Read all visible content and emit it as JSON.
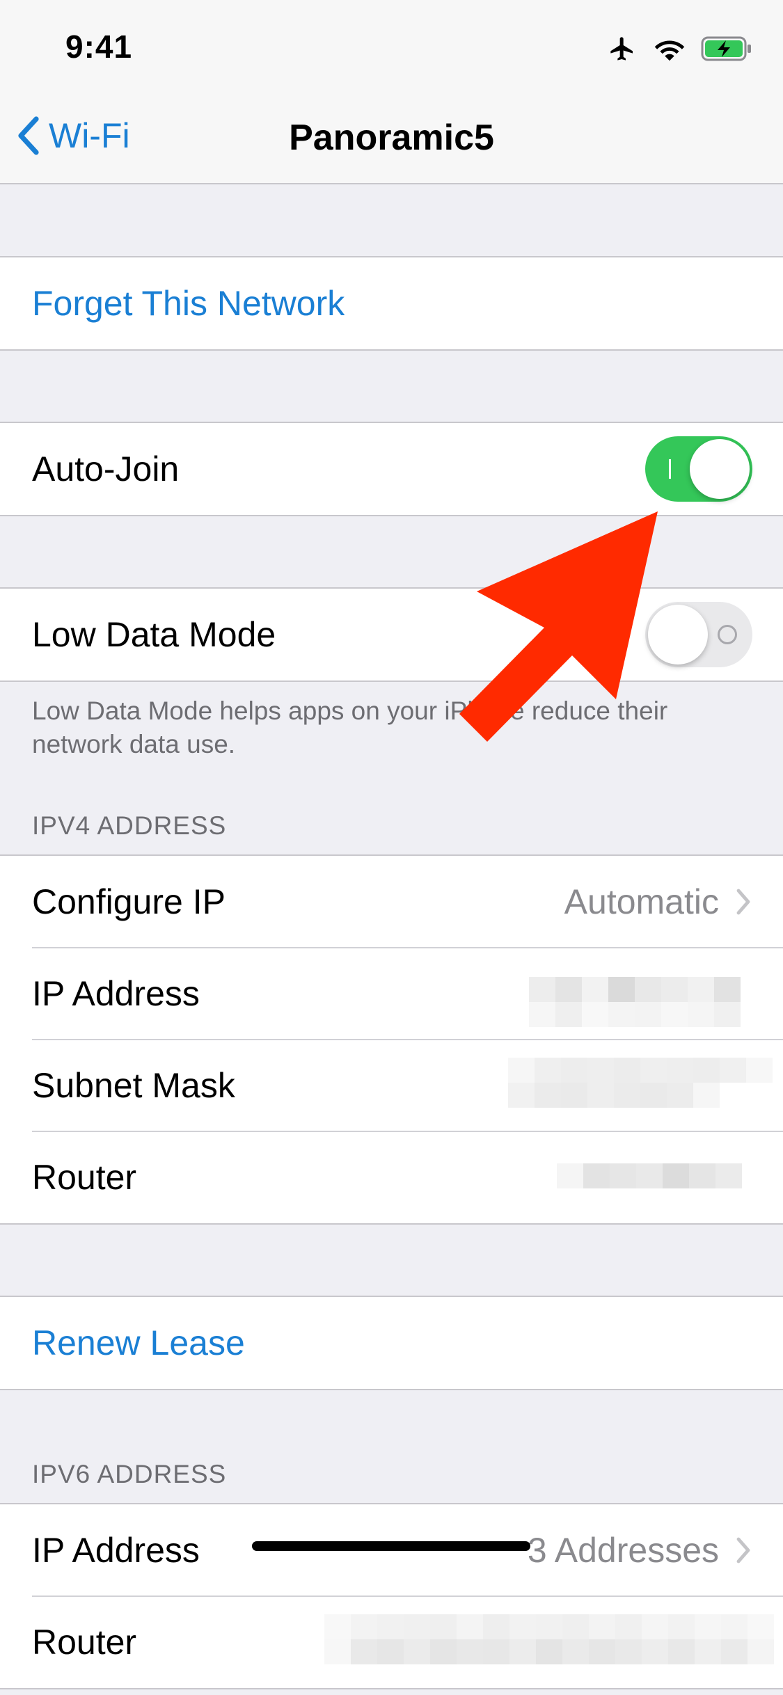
{
  "status_bar": {
    "time": "9:41",
    "icons": [
      "airplane-icon",
      "wifi-icon",
      "battery-charging-icon"
    ]
  },
  "nav": {
    "back_label": "Wi-Fi",
    "title": "Panoramic5"
  },
  "forget": {
    "label": "Forget This Network"
  },
  "auto_join": {
    "label": "Auto-Join",
    "on": true
  },
  "low_data": {
    "label": "Low Data Mode",
    "on": false,
    "footer": "Low Data Mode helps apps on your iPhone reduce their network data use."
  },
  "ipv4": {
    "header": "IPV4 ADDRESS",
    "configure_label": "Configure IP",
    "configure_value": "Automatic",
    "ip_label": "IP Address",
    "subnet_label": "Subnet Mask",
    "router_label": "Router"
  },
  "renew": {
    "label": "Renew Lease"
  },
  "ipv6": {
    "header": "IPV6 ADDRESS",
    "ip_label": "IP Address",
    "ip_value": "3 Addresses",
    "router_label": "Router"
  },
  "colors": {
    "accent": "#1a7fd4",
    "toggle_on": "#34c759",
    "annotation_arrow": "#ff2a00"
  }
}
